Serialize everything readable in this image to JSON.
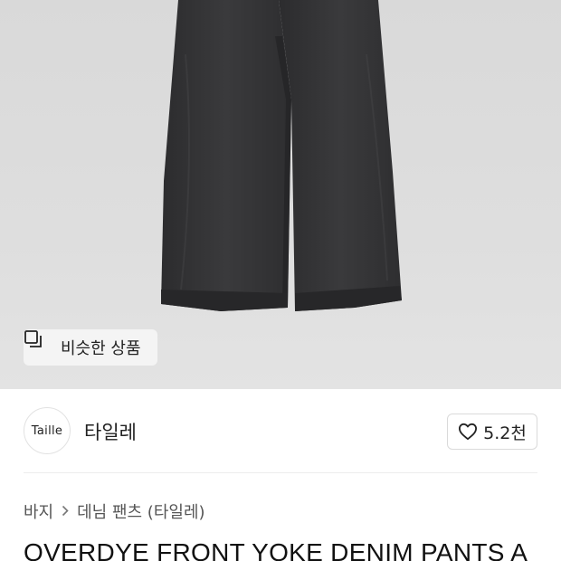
{
  "similar_button": {
    "label": "비슷한 상품",
    "icon": "similar-items-icon"
  },
  "brand": {
    "logo_text": "Taille",
    "name": "타일레"
  },
  "like": {
    "count": "5.2천",
    "icon": "heart-icon"
  },
  "breadcrumb": {
    "items": [
      "바지",
      "데님 팬츠 (타일레)"
    ],
    "separator_icon": "chevron-right-icon"
  },
  "product": {
    "title": "OVERDYE FRONT YOKE DENIM PANTS A"
  }
}
